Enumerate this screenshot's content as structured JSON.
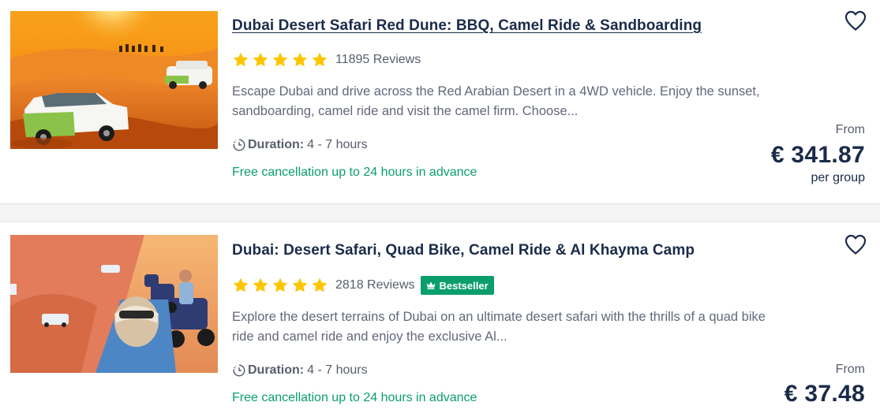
{
  "results": [
    {
      "title": "Dubai Desert Safari Red Dune: BBQ, Camel Ride & Sandboarding",
      "stars": 5,
      "reviews": "11895 Reviews",
      "badge": "",
      "description_line1": "Escape Dubai and drive across the Red Arabian Desert in a 4WD vehicle. Enjoy the sunset,",
      "description_line2": "sandboarding, camel ride and visit the camel firm. Choose...",
      "duration_label": "Duration:",
      "duration_value": "4 - 7 hours",
      "cancellation": "Free cancellation up to 24 hours in advance",
      "price_from": "From",
      "price": "€ 341.87",
      "price_unit": "per group",
      "image": "desert-4wd-sunset-photo",
      "favorite_icon": "heart-outline-icon"
    },
    {
      "title": "Dubai: Desert Safari, Quad Bike, Camel Ride & Al Khayma Camp",
      "stars": 5,
      "reviews": "2818 Reviews",
      "badge": "Bestseller",
      "description_line1": "Explore the desert terrains of Dubai on an ultimate desert safari with the thrills of a quad bike",
      "description_line2": "ride and camel ride and enjoy the exclusive Al...",
      "duration_label": "Duration:",
      "duration_value": "4 - 7 hours",
      "cancellation": "Free cancellation up to 24 hours in advance",
      "price_from": "From",
      "price": "€ 37.48",
      "image": "desert-quad-bike-selfie-photo",
      "favorite_icon": "heart-outline-icon"
    }
  ],
  "colors": {
    "title": "#1a2b49",
    "star": "#fdc600",
    "green": "#0a9e6c",
    "muted": "#585e6b"
  }
}
